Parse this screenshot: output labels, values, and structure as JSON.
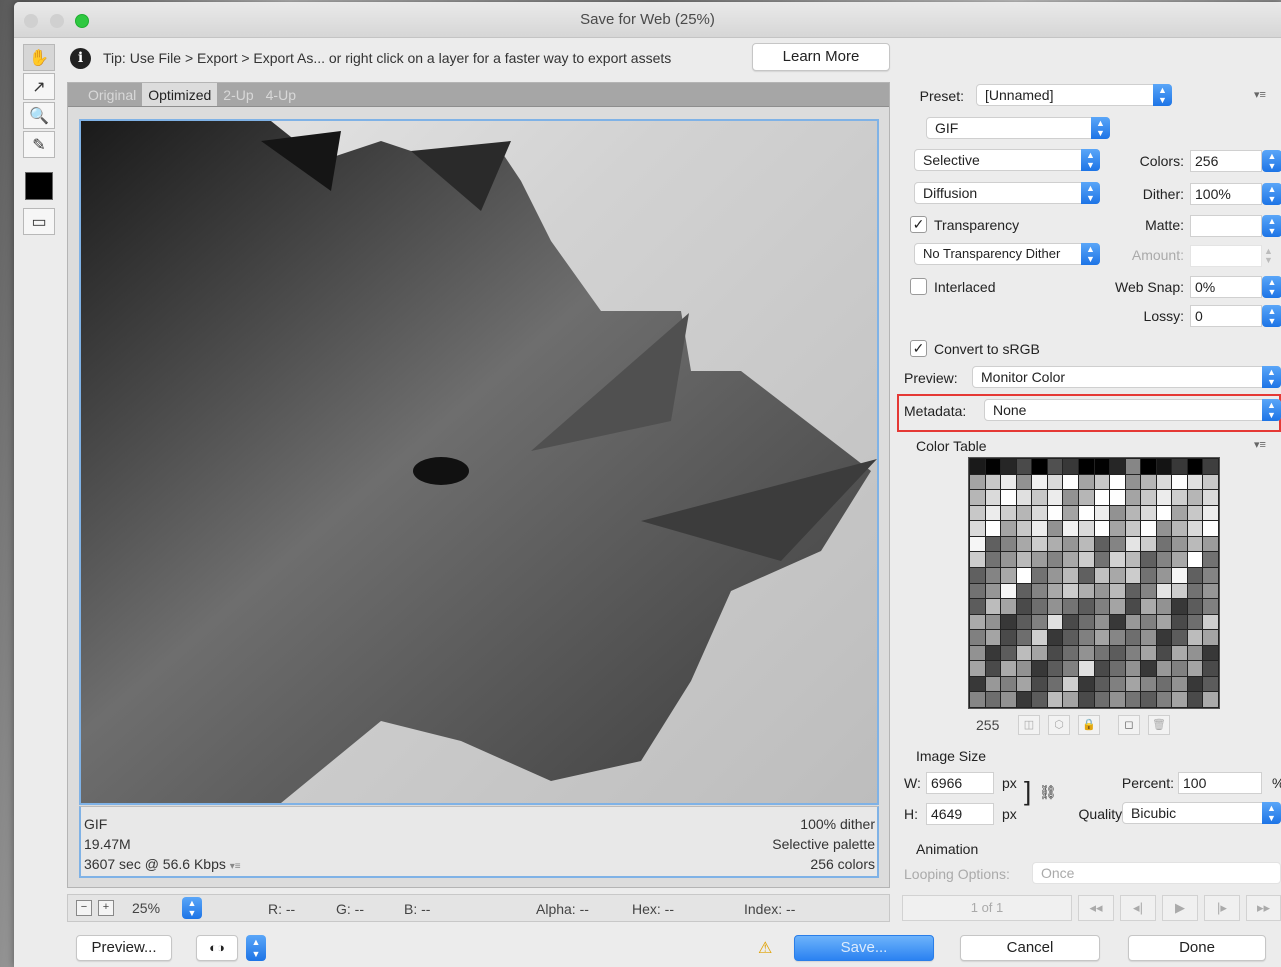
{
  "window": {
    "title": "Save for Web (25%)"
  },
  "tip": {
    "text": "Tip: Use File > Export > Export As... or right click on a layer for a faster way to export assets",
    "learn_more": "Learn More"
  },
  "tabs": [
    "Original",
    "Optimized",
    "2-Up",
    "4-Up"
  ],
  "image_info": {
    "format": "GIF",
    "size": "19.47M",
    "time": "3607 sec @ 56.6 Kbps",
    "dither": "100% dither",
    "palette": "Selective palette",
    "colors": "256 colors"
  },
  "status": {
    "zoom": "25%",
    "r": "R: --",
    "g": "G: --",
    "b": "B: --",
    "alpha": "Alpha: --",
    "hex": "Hex: --",
    "index": "Index: --"
  },
  "buttons": {
    "preview": "Preview...",
    "save": "Save...",
    "cancel": "Cancel",
    "done": "Done"
  },
  "settings": {
    "preset_label": "Preset:",
    "preset_value": "[Unnamed]",
    "format": "GIF",
    "reduction": "Selective",
    "dither_algo": "Diffusion",
    "colors_label": "Colors:",
    "colors_value": "256",
    "dither_label": "Dither:",
    "dither_value": "100%",
    "transparency_label": "Transparency",
    "transparency_checked": true,
    "matte_label": "Matte:",
    "transparency_dither": "No Transparency Dither",
    "amount_label": "Amount:",
    "interlaced_label": "Interlaced",
    "interlaced_checked": false,
    "websnap_label": "Web Snap:",
    "websnap_value": "0%",
    "lossy_label": "Lossy:",
    "lossy_value": "0",
    "convert_srgb_label": "Convert to sRGB",
    "convert_srgb_checked": true,
    "preview_label": "Preview:",
    "preview_value": "Monitor Color",
    "metadata_label": "Metadata:",
    "metadata_value": "None"
  },
  "color_table": {
    "title": "Color Table",
    "count": "255"
  },
  "image_size": {
    "title": "Image Size",
    "w_label": "W:",
    "w_value": "6966",
    "w_unit": "px",
    "h_label": "H:",
    "h_value": "4649",
    "h_unit": "px",
    "percent_label": "Percent:",
    "percent_value": "100",
    "quality_label": "Quality:",
    "quality_value": "Bicubic"
  },
  "animation": {
    "title": "Animation",
    "looping_label": "Looping Options:",
    "looping_value": "Once",
    "frame": "1 of 1"
  },
  "colors": {
    "accent": "#2b82f1",
    "highlight": "#e53935",
    "frame": "#7fb2e6"
  }
}
